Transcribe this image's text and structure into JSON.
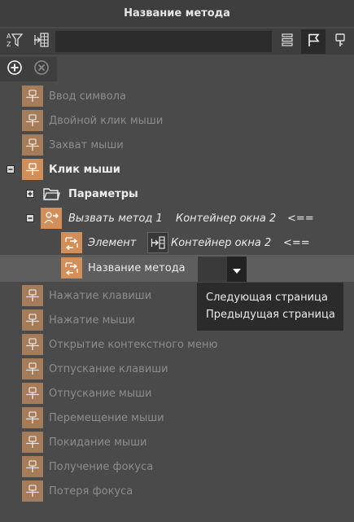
{
  "title": "Название метода",
  "tree": {
    "items": [
      {
        "label": "Ввод символа"
      },
      {
        "label": "Двойной клик мыши"
      },
      {
        "label": "Захват мыши"
      },
      {
        "label": "Клик мыши"
      },
      {
        "label": "Параметры"
      },
      {
        "label": "Вызвать метод 1",
        "target": "Контейнер окна 2",
        "arrow": "<=="
      },
      {
        "label": "Элемент",
        "target": "Контейнер окна 2",
        "arrow": "<=="
      },
      {
        "label": "Название метода"
      },
      {
        "label": "Нажатие клавиши"
      },
      {
        "label": "Нажатие мыши"
      },
      {
        "label": "Открытие контекстного меню"
      },
      {
        "label": "Отпускание клавиши"
      },
      {
        "label": "Отпускание мыши"
      },
      {
        "label": "Перемещение мыши"
      },
      {
        "label": "Покидание мыши"
      },
      {
        "label": "Получение фокуса"
      },
      {
        "label": "Потеря фокуса"
      }
    ]
  },
  "dropdown": {
    "options": [
      "Следующая страница",
      "Предыдущая страница"
    ]
  },
  "colors": {
    "background": "#4a4a4a",
    "event_icon_faded": "#a47c5a",
    "event_icon_active": "#d38f59",
    "text_dim": "#8d8d8d",
    "text_bright": "#ececec"
  }
}
